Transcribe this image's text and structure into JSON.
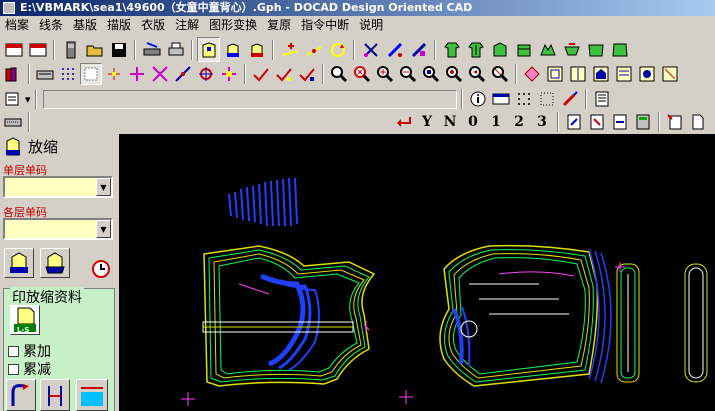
{
  "window": {
    "title": "E:\\VBMARK\\sea1\\49600（女童中童背心）.Gph - DOCAD Design Oriented CAD"
  },
  "menu": [
    "档案",
    "线条",
    "基版",
    "描版",
    "衣版",
    "注解",
    "图形变换",
    "复原",
    "指令中断",
    "说明"
  ],
  "toolbar_row4": {
    "glyphs": [
      "Y",
      "N",
      "0",
      "1",
      "2",
      "3"
    ]
  },
  "left_panel": {
    "title": "放缩",
    "single_layer_label": "单层单码",
    "multi_layer_label": "各层单码",
    "single_layer_value": "",
    "multi_layer_value": "",
    "group_title": "印放缩资料",
    "ls_badge": "L-S",
    "cumulative_add": "累加",
    "cumulative_sub": "累减"
  },
  "colors": {
    "canvas_bg": "#000000",
    "pattern_yellow": "#e0e000",
    "pattern_green": "#00ff60",
    "pattern_blue": "#2040ff",
    "pattern_magenta": "#ff40ff",
    "pattern_white": "#ffffff"
  }
}
